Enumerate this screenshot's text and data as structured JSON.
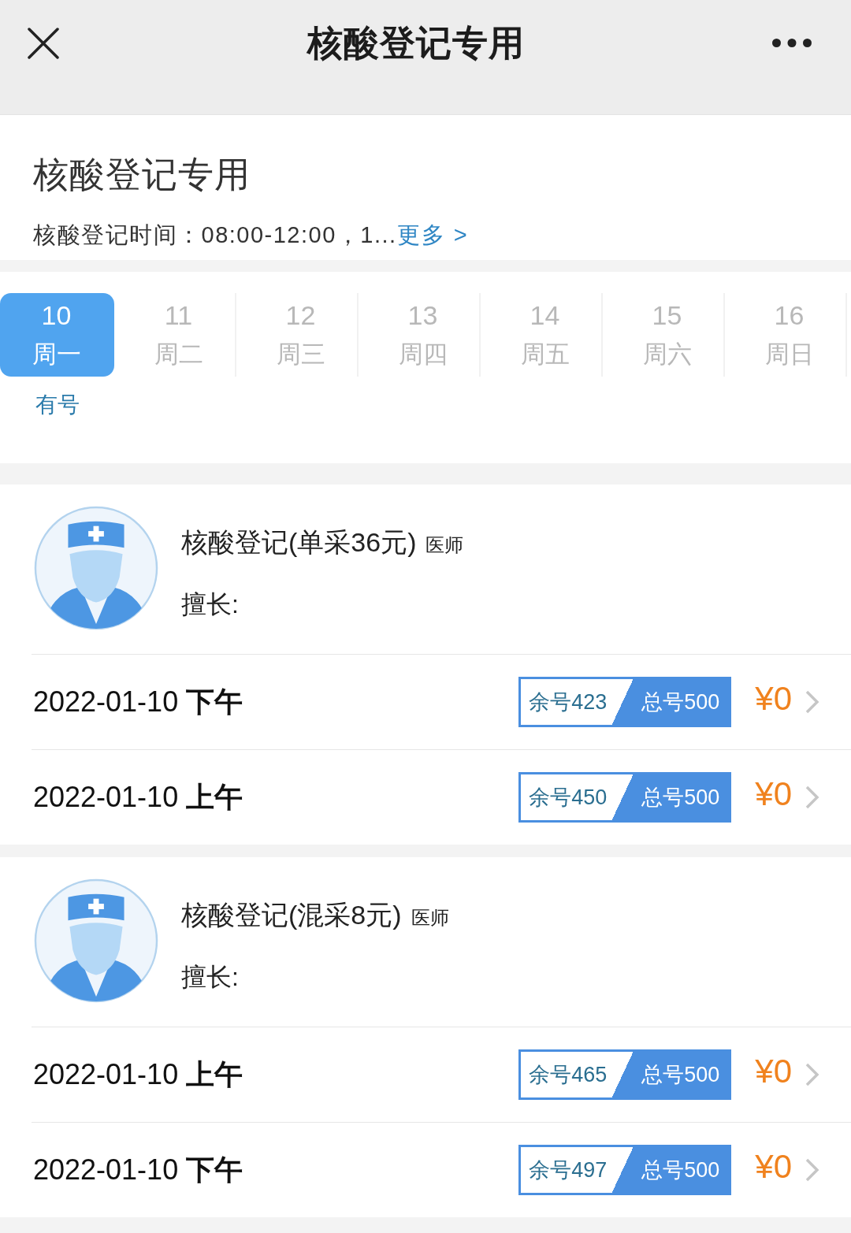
{
  "nav_bar": {
    "title": "核酸登记专用"
  },
  "header": {
    "title": "核酸登记专用",
    "hours": "核酸登记时间：08:00-12:00，1...",
    "more_link": "更多 >"
  },
  "dates": [
    {
      "day": "10",
      "weekday": "周一",
      "selected": true,
      "status": "有号"
    },
    {
      "day": "11",
      "weekday": "周二",
      "selected": false
    },
    {
      "day": "12",
      "weekday": "周三",
      "selected": false
    },
    {
      "day": "13",
      "weekday": "周四",
      "selected": false
    },
    {
      "day": "14",
      "weekday": "周五",
      "selected": false
    },
    {
      "day": "15",
      "weekday": "周六",
      "selected": false
    },
    {
      "day": "16",
      "weekday": "周日",
      "selected": false
    }
  ],
  "doctors": [
    {
      "name": "核酸登记(单采36元)",
      "title": "医师",
      "specialty": "擅长:",
      "slots": [
        {
          "time": "2022-01-10 **下午**",
          "remaining": "余号423",
          "total": "总号500",
          "price": "¥0"
        },
        {
          "time": "2022-01-10 **上午**",
          "remaining": "余号450",
          "total": "总号500",
          "price": "¥0"
        }
      ]
    },
    {
      "name": "核酸登记(混采8元)",
      "title": "医师",
      "specialty": "擅长:",
      "slots": [
        {
          "time": "2022-01-10 **上午**",
          "remaining": "余号465",
          "total": "总号500",
          "price": "¥0"
        },
        {
          "time": "2022-01-10 **下午**",
          "remaining": "余号497",
          "total": "总号500",
          "price": "¥0"
        }
      ]
    }
  ]
}
